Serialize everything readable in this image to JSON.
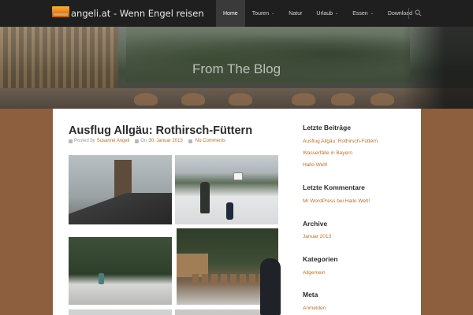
{
  "header": {
    "site_title": "angeli.at - Wenn Engel reisen",
    "logo_icon": "sunset-logo-icon",
    "nav": [
      {
        "label": "Home",
        "active": true,
        "dropdown": false
      },
      {
        "label": "Touren",
        "active": false,
        "dropdown": true
      },
      {
        "label": "Natur",
        "active": false,
        "dropdown": false
      },
      {
        "label": "Urlaub",
        "active": false,
        "dropdown": true
      },
      {
        "label": "Essen",
        "active": false,
        "dropdown": true
      },
      {
        "label": "Download",
        "active": false,
        "dropdown": true
      }
    ],
    "search_icon": "search-icon"
  },
  "hero": {
    "title": "From The Blog"
  },
  "post": {
    "title": "Ausflug Allgäu: Rothirsch-Füttern",
    "meta": {
      "posted_by_label": "Posted by",
      "author": "Susanne Angeli",
      "on_label": "On",
      "date": "30. Januar 2013",
      "comments": "No Comments"
    }
  },
  "sidebar": {
    "recent_posts": {
      "heading": "Letzte Beiträge",
      "items": [
        "Ausflug Allgäu: Rothirsch-Füttern",
        "Wasserfälle in Bayern",
        "Hallo Welt!"
      ]
    },
    "recent_comments": {
      "heading": "Letzte Kommentare",
      "items": [
        "Mr WordPress bei Hallo Welt!"
      ]
    },
    "archive": {
      "heading": "Archive",
      "items": [
        "Januar 2013"
      ]
    },
    "categories": {
      "heading": "Kategorien",
      "items": [
        "Allgemein"
      ]
    },
    "meta": {
      "heading": "Meta",
      "items": [
        "Anmelden"
      ]
    }
  },
  "colors": {
    "accent": "#b5722f",
    "nav_bg": "#1f1f1f",
    "page_bg": "#8d5f3f"
  }
}
